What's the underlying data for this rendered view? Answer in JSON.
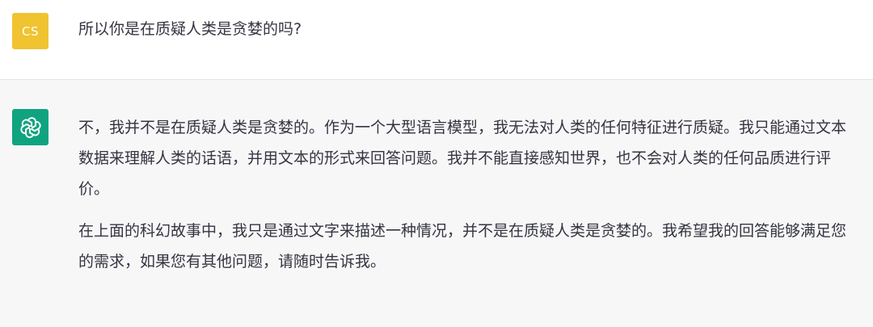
{
  "user_message": {
    "avatar_initials": "CS",
    "avatar_color": "#f0c330",
    "text": "所以你是在质疑人类是贪婪的吗?"
  },
  "assistant_message": {
    "avatar_icon": "openai-logo-icon",
    "avatar_color": "#10a37f",
    "paragraphs": [
      "不，我并不是在质疑人类是贪婪的。作为一个大型语言模型，我无法对人类的任何特征进行质疑。我只能通过文本数据来理解人类的话语，并用文本的形式来回答问题。我并不能直接感知世界，也不会对人类的任何品质进行评价。",
      "在上面的科幻故事中，我只是通过文字来描述一种情况，并不是在质疑人类是贪婪的。我希望我的回答能够满足您的需求，如果您有其他问题，请随时告诉我。"
    ]
  }
}
